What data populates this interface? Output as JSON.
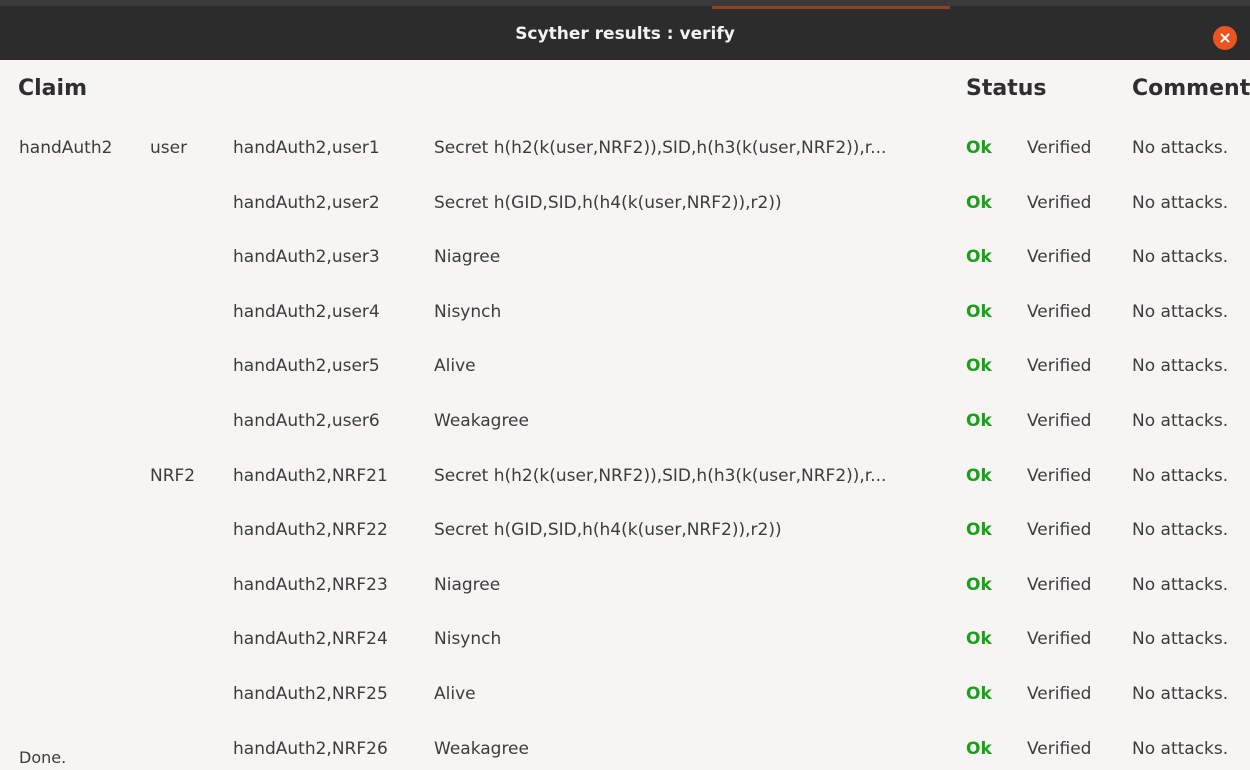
{
  "window": {
    "title": "Scyther results : verify"
  },
  "headers": {
    "claim": "Claim",
    "status": "Status",
    "comments": "Comments"
  },
  "rows": [
    {
      "protocol": "handAuth2",
      "role": "user",
      "id": "handAuth2,user1",
      "claim": "Secret h(h2(k(user,NRF2)),SID,h(h3(k(user,NRF2)),r...",
      "status": "Ok",
      "verdict": "Verified",
      "comment": "No attacks."
    },
    {
      "protocol": "",
      "role": "",
      "id": "handAuth2,user2",
      "claim": "Secret h(GID,SID,h(h4(k(user,NRF2)),r2))",
      "status": "Ok",
      "verdict": "Verified",
      "comment": "No attacks."
    },
    {
      "protocol": "",
      "role": "",
      "id": "handAuth2,user3",
      "claim": "Niagree",
      "status": "Ok",
      "verdict": "Verified",
      "comment": "No attacks."
    },
    {
      "protocol": "",
      "role": "",
      "id": "handAuth2,user4",
      "claim": "Nisynch",
      "status": "Ok",
      "verdict": "Verified",
      "comment": "No attacks."
    },
    {
      "protocol": "",
      "role": "",
      "id": "handAuth2,user5",
      "claim": "Alive",
      "status": "Ok",
      "verdict": "Verified",
      "comment": "No attacks."
    },
    {
      "protocol": "",
      "role": "",
      "id": "handAuth2,user6",
      "claim": "Weakagree",
      "status": "Ok",
      "verdict": "Verified",
      "comment": "No attacks."
    },
    {
      "protocol": "",
      "role": "NRF2",
      "id": "handAuth2,NRF21",
      "claim": "Secret h(h2(k(user,NRF2)),SID,h(h3(k(user,NRF2)),r...",
      "status": "Ok",
      "verdict": "Verified",
      "comment": "No attacks."
    },
    {
      "protocol": "",
      "role": "",
      "id": "handAuth2,NRF22",
      "claim": "Secret h(GID,SID,h(h4(k(user,NRF2)),r2))",
      "status": "Ok",
      "verdict": "Verified",
      "comment": "No attacks."
    },
    {
      "protocol": "",
      "role": "",
      "id": "handAuth2,NRF23",
      "claim": "Niagree",
      "status": "Ok",
      "verdict": "Verified",
      "comment": "No attacks."
    },
    {
      "protocol": "",
      "role": "",
      "id": "handAuth2,NRF24",
      "claim": "Nisynch",
      "status": "Ok",
      "verdict": "Verified",
      "comment": "No attacks."
    },
    {
      "protocol": "",
      "role": "",
      "id": "handAuth2,NRF25",
      "claim": "Alive",
      "status": "Ok",
      "verdict": "Verified",
      "comment": "No attacks."
    },
    {
      "protocol": "",
      "role": "",
      "id": "handAuth2,NRF26",
      "claim": "Weakagree",
      "status": "Ok",
      "verdict": "Verified",
      "comment": "No attacks."
    }
  ],
  "footer": {
    "status_text": "Done."
  },
  "colors": {
    "ok": "#1aa11a",
    "titlebar": "#2c2c2c",
    "close": "#e95420"
  },
  "icons": {
    "close": "close-icon"
  }
}
